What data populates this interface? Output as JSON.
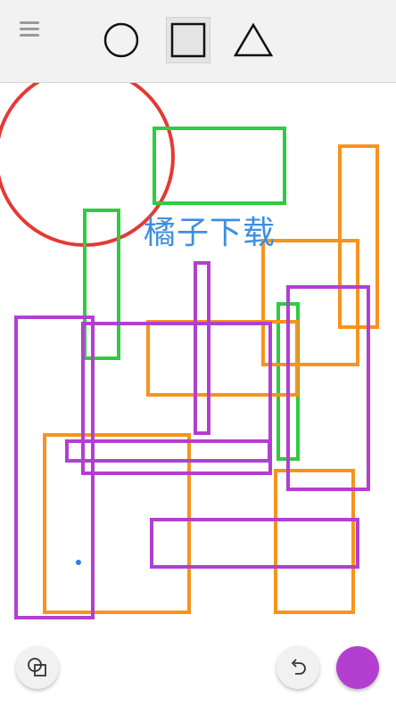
{
  "toolbar": {
    "menu_icon": "hamburger-menu-icon",
    "tools": [
      {
        "name": "circle-tool",
        "icon": "circle-icon",
        "selected": false
      },
      {
        "name": "square-tool",
        "icon": "square-icon",
        "selected": true
      },
      {
        "name": "triangle-tool",
        "icon": "triangle-icon",
        "selected": false
      }
    ]
  },
  "canvas": {
    "watermark_text": "橘子下载",
    "colors": {
      "red": "#e53935",
      "green": "#2ecc40",
      "orange": "#f7931e",
      "purple": "#b23fd0",
      "blue_dot": "#2f7de1"
    }
  },
  "bottom_bar": {
    "shapes_icon": "shapes-icon",
    "undo_icon": "undo-icon",
    "current_color": "#b23fd0"
  }
}
